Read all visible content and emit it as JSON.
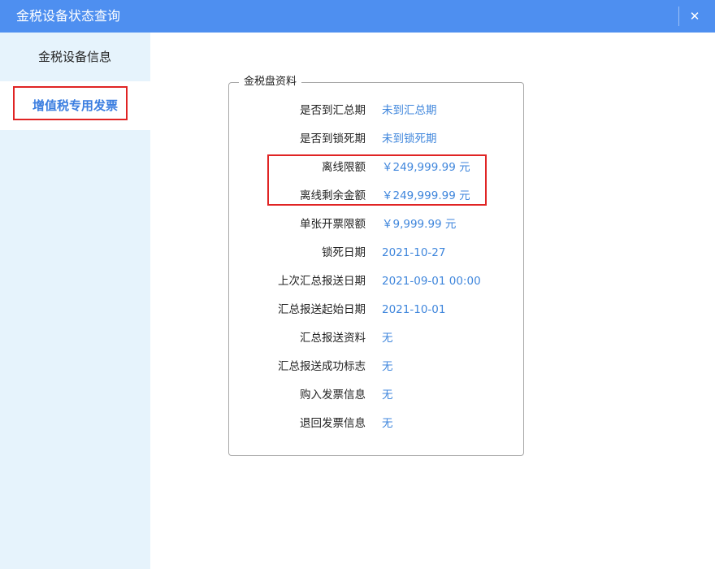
{
  "window": {
    "title": "金税设备状态查询",
    "close_label": "✕"
  },
  "sidebar": {
    "items": [
      {
        "label": "金税设备信息"
      },
      {
        "label": "增值税专用发票"
      }
    ]
  },
  "panel": {
    "legend": "金税盘资料",
    "rows": [
      {
        "key": "是否到汇总期",
        "value": "未到汇总期"
      },
      {
        "key": "是否到锁死期",
        "value": "未到锁死期"
      },
      {
        "key": "离线限额",
        "value": "￥249,999.99 元"
      },
      {
        "key": "离线剩余金额",
        "value": "￥249,999.99 元"
      },
      {
        "key": "单张开票限额",
        "value": "￥9,999.99 元"
      },
      {
        "key": "锁死日期",
        "value": "2021-10-27"
      },
      {
        "key": "上次汇总报送日期",
        "value": "2021-09-01 00:00"
      },
      {
        "key": "汇总报送起始日期",
        "value": "2021-10-01"
      },
      {
        "key": "汇总报送资料",
        "value": "无"
      },
      {
        "key": "汇总报送成功标志",
        "value": "无"
      },
      {
        "key": "购入发票信息",
        "value": "无"
      },
      {
        "key": "退回发票信息",
        "value": "无"
      }
    ]
  }
}
